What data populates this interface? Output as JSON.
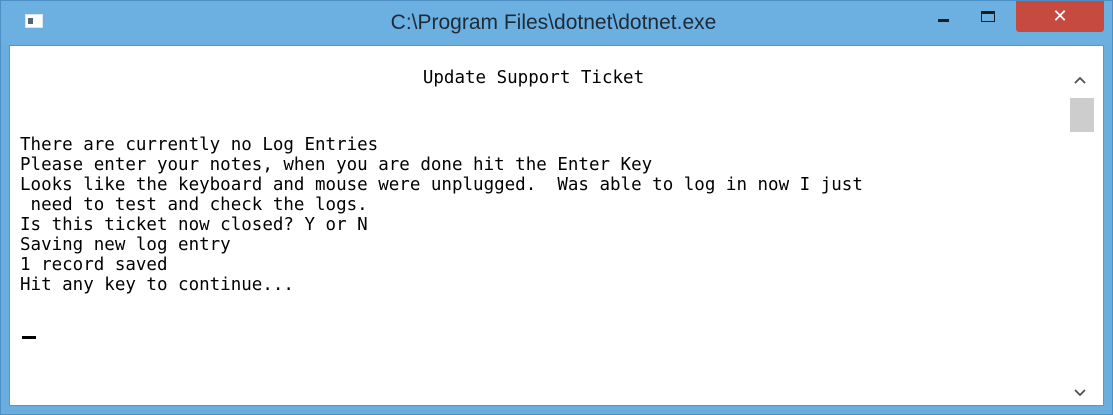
{
  "window": {
    "title": "C:\\Program Files\\dotnet\\dotnet.exe",
    "close_label": "✕"
  },
  "console": {
    "heading": "Update Support Ticket",
    "lines": [
      "There are currently no Log Entries",
      "Please enter your notes, when you are done hit the Enter Key",
      "Looks like the keyboard and mouse were unplugged.  Was able to log in now I just",
      " need to test and check the logs.",
      "Is this ticket now closed? Y or N",
      "Saving new log entry",
      "1 record saved",
      "Hit any key to continue..."
    ]
  },
  "icons": {
    "app": "console-app-icon",
    "minimize": "minimize-icon",
    "maximize": "maximize-icon",
    "close": "close-icon",
    "scroll_up": "chevron-up-icon",
    "scroll_down": "chevron-down-icon"
  },
  "colors": {
    "titlebar": "#6cb0e2",
    "close_button": "#c74a40",
    "console_background": "#ffffff",
    "console_text": "#000000"
  }
}
